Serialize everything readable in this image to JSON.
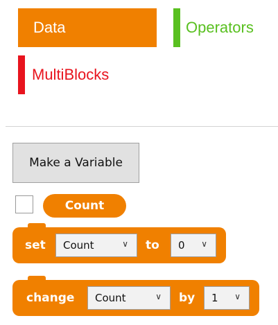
{
  "categories": [
    {
      "label": "Data",
      "color": "#f08000",
      "selected": true
    },
    {
      "label": "Operators",
      "color": "#59c020"
    },
    {
      "label": "MultiBlocks",
      "color": "#e8141e"
    }
  ],
  "palette": {
    "make_variable_label": "Make a Variable",
    "variable_reporter": "Count",
    "set_block": {
      "keyword": "set",
      "variable": "Count",
      "connector": "to",
      "value": "0"
    },
    "change_block": {
      "keyword": "change",
      "variable": "Count",
      "connector": "by",
      "value": "1"
    },
    "block_color": "#f08000"
  }
}
